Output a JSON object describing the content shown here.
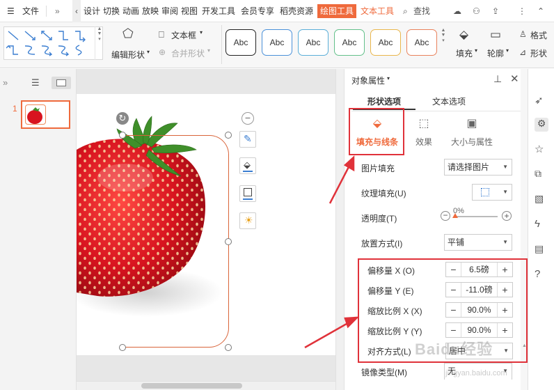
{
  "menubar": {
    "file_label": "文件",
    "items": [
      "设计",
      "切换",
      "动画",
      "放映",
      "审阅",
      "视图",
      "开发工具",
      "会员专享",
      "稻壳资源"
    ],
    "drawing_tools_tab": "绘图工具",
    "text_tools_tab": "文本工具",
    "search_label": "查找"
  },
  "ribbon": {
    "edit_shape_label": "编辑形状",
    "textbox_label": "文本框",
    "merge_shape_label": "合并形状",
    "style_samples": [
      "Abc",
      "Abc",
      "Abc",
      "Abc",
      "Abc",
      "Abc"
    ],
    "style_colors": [
      "#222222",
      "#4a90d9",
      "#5aaed8",
      "#63c08a",
      "#e9b64c",
      "#e9825c"
    ],
    "fill_label": "填充",
    "outline_label": "轮廓",
    "format_label": "格式",
    "shape_label": "形状"
  },
  "slides": {
    "number": "1"
  },
  "panel": {
    "title": "对象属性",
    "tabs": {
      "shape_options": "形状选项",
      "text_options": "文本选项"
    },
    "subtabs": {
      "fill_line": "填充与线条",
      "effects": "效果",
      "size_props": "大小与属性"
    },
    "picture_fill": {
      "label": "图片填充",
      "value": "请选择图片"
    },
    "texture_fill": {
      "label": "纹理填充(U)"
    },
    "transparency": {
      "label": "透明度(T)",
      "value": "0%"
    },
    "placement": {
      "label": "放置方式(I)",
      "value": "平铺"
    },
    "offset_x": {
      "label": "偏移量 X (O)",
      "value": "6.5磅"
    },
    "offset_y": {
      "label": "偏移量 Y (E)",
      "value": "-11.0磅"
    },
    "scale_x": {
      "label": "缩放比例 X (X)",
      "value": "90.0%"
    },
    "scale_y": {
      "label": "缩放比例 Y (Y)",
      "value": "90.0%"
    },
    "align": {
      "label": "对齐方式(L)",
      "value": "居中"
    },
    "mirror": {
      "label": "镜像类型(M)",
      "value": "无"
    }
  },
  "watermark": {
    "main": "Baidu经验",
    "sub": "jingyan.baidu.com"
  },
  "colors": {
    "accent": "#ef6a3c",
    "annotation": "#e0323a"
  }
}
